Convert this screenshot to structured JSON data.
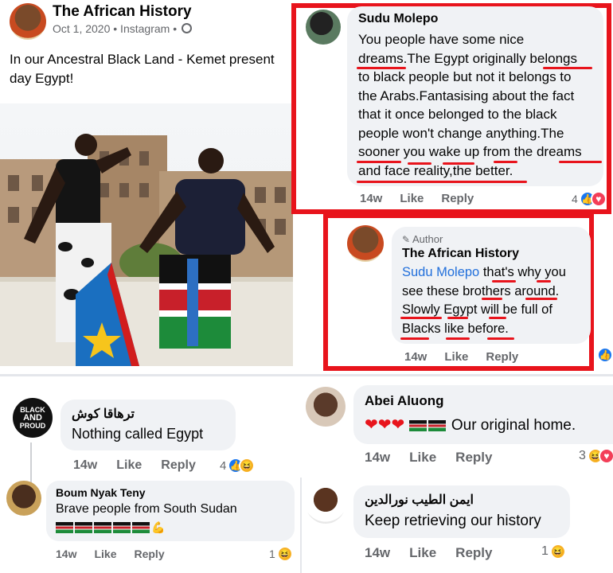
{
  "post": {
    "author": "The African History",
    "meta": "Oct 1, 2020 • Instagram •",
    "text_line1": "In our Ancestral Black Land - Kemet present",
    "text_line2": "day Egypt!"
  },
  "comments": {
    "sudu": {
      "name": "Sudu Molepo",
      "lines": [
        "You people have some nice",
        "dreams.The Egypt originally belongs",
        "to black people but not it belongs to",
        "the Arabs.Fantasising about the fact",
        "that it once belonged to the black",
        "people won't change anything.The",
        "sooner you wake up from the dreams",
        "and face reality,the better."
      ],
      "time": "14w",
      "like": "Like",
      "reply": "Reply",
      "reaction_count": "4"
    },
    "reply_author": {
      "badge": "Author",
      "name": "The African History",
      "mention": "Sudu Molepo",
      "line1_rest": " that's why you",
      "lines": [
        "see these brothers around.",
        "Slowly Egypt will be full of",
        "Blacks like before."
      ],
      "time": "14w",
      "like": "Like",
      "reply": "Reply"
    },
    "tarhaka": {
      "name": "ترهاقا كوش",
      "text": "Nothing called Egypt",
      "avatar_text": [
        "BLACK",
        "AND",
        "PROUD"
      ],
      "time": "14w",
      "like": "Like",
      "reply": "Reply",
      "reaction_count": "4"
    },
    "abei": {
      "name": "Abei Aluong",
      "text": "Our original home.",
      "time": "14w",
      "like": "Like",
      "reply": "Reply",
      "reaction_count": "3"
    },
    "boum": {
      "name": "Boum Nyak Teny",
      "text": "Brave people from South Sudan",
      "time": "14w",
      "like": "Like",
      "reply": "Reply",
      "reaction_count": "1"
    },
    "ayman": {
      "name": "ايمن الطيب نورالدين",
      "text": "Keep retrieving our history",
      "time": "14w",
      "like": "Like",
      "reply": "Reply",
      "reaction_count": "1"
    }
  },
  "colors": {
    "red_frame": "#e8141c",
    "link_blue": "#216fdb",
    "bubble": "#f0f2f5",
    "muted": "#65676b"
  }
}
